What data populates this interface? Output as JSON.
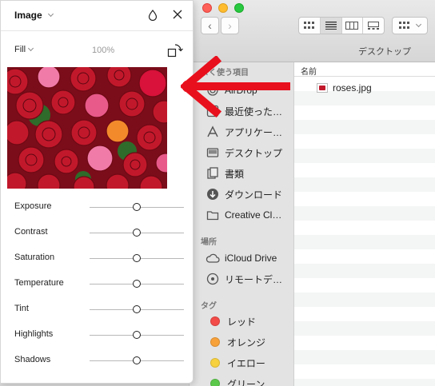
{
  "finder": {
    "window_title": "デスクトップ",
    "nav": {
      "back_glyph": "‹",
      "forward_glyph": "›"
    },
    "view_modes": [
      "icon-view-icon",
      "list-view-icon",
      "column-view-icon",
      "gallery-view-icon"
    ],
    "active_view": "list-view-icon",
    "sidebar": {
      "favorites_header": "よく使う項目",
      "favorites": [
        {
          "label": "AirDrop",
          "icon": "airdrop-icon"
        },
        {
          "label": "最近使った…",
          "icon": "recents-icon"
        },
        {
          "label": "アプリケー…",
          "icon": "applications-icon"
        },
        {
          "label": "デスクトップ",
          "icon": "desktop-icon"
        },
        {
          "label": "書類",
          "icon": "documents-icon"
        },
        {
          "label": "ダウンロード",
          "icon": "downloads-icon"
        },
        {
          "label": "Creative Cl…",
          "icon": "folder-icon"
        }
      ],
      "locations_header": "場所",
      "locations": [
        {
          "label": "iCloud Drive",
          "icon": "icloud-icon"
        },
        {
          "label": "リモートデ…",
          "icon": "remote-disc-icon"
        }
      ],
      "tags_header": "タグ",
      "tags": [
        {
          "label": "レッド",
          "color": "#f24b48"
        },
        {
          "label": "オレンジ",
          "color": "#f7a13a"
        },
        {
          "label": "イエロー",
          "color": "#f7d13e"
        },
        {
          "label": "グリーン",
          "color": "#5cc84b"
        }
      ]
    },
    "filelist": {
      "column_header": "名前",
      "files": [
        {
          "name": "roses.jpg",
          "icon": "jpeg-file-icon"
        }
      ]
    }
  },
  "panel": {
    "title": "Image",
    "fill_label": "Fill",
    "fill_opacity": "100%",
    "image_alt": "roses photo",
    "adjustments": [
      {
        "label": "Exposure",
        "value": 0.5
      },
      {
        "label": "Contrast",
        "value": 0.5
      },
      {
        "label": "Saturation",
        "value": 0.5
      },
      {
        "label": "Temperature",
        "value": 0.5
      },
      {
        "label": "Tint",
        "value": 0.5
      },
      {
        "label": "Highlights",
        "value": 0.5
      },
      {
        "label": "Shadows",
        "value": 0.5
      }
    ]
  },
  "colors": {
    "accent_arrow": "#e8101d",
    "rose_red": "#c2182b",
    "rose_pink": "#f07aa8"
  }
}
